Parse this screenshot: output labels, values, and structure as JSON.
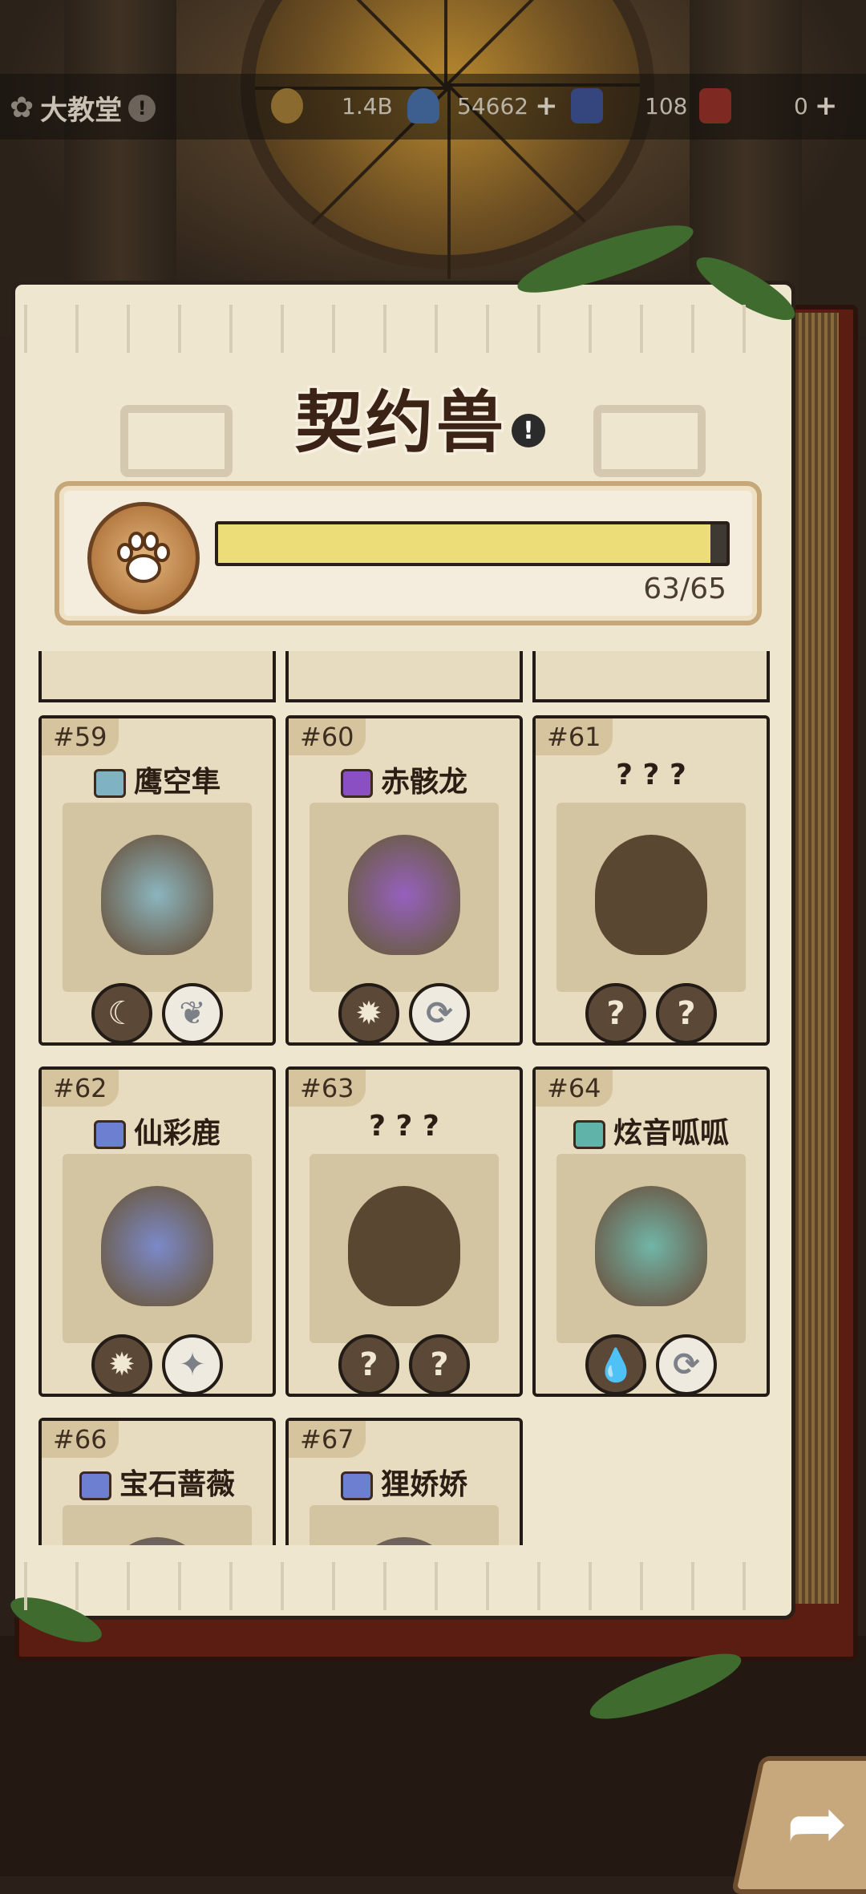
{
  "topbar": {
    "location": "大教堂",
    "info_icon": "!",
    "resources": [
      {
        "icon": "gold-coin-icon",
        "value": "1.4B",
        "plus": ""
      },
      {
        "icon": "blue-crystal-icon",
        "value": "54662",
        "plus": "+"
      },
      {
        "icon": "blue-ticket-icon",
        "value": "108",
        "plus": ""
      },
      {
        "icon": "red-ticket-icon",
        "value": "0",
        "plus": "+"
      }
    ]
  },
  "book": {
    "title": "契约兽",
    "info_icon": "!",
    "progress": {
      "collected": 63,
      "total": 65,
      "text": "63/65",
      "fraction": 0.969
    }
  },
  "cards": [
    {
      "num": "#59",
      "name": "鹰空隼",
      "emblem_color": "#7fb3c4",
      "known": true,
      "badges": [
        "moon",
        "leaf"
      ]
    },
    {
      "num": "#60",
      "name": "赤骸龙",
      "emblem_color": "#8b4fc4",
      "known": true,
      "badges": [
        "sun",
        "wind"
      ]
    },
    {
      "num": "#61",
      "name": "? ? ?",
      "emblem_color": "",
      "known": false,
      "badges": [
        "?",
        "?"
      ]
    },
    {
      "num": "#62",
      "name": "仙彩鹿",
      "emblem_color": "#6c7fd1",
      "known": true,
      "badges": [
        "sun",
        "star"
      ]
    },
    {
      "num": "#63",
      "name": "? ? ?",
      "emblem_color": "",
      "known": false,
      "badges": [
        "?",
        "?"
      ]
    },
    {
      "num": "#64",
      "name": "炫音呱呱",
      "emblem_color": "#5fb3a8",
      "known": true,
      "badges": [
        "water",
        "wind"
      ]
    },
    {
      "num": "#66",
      "name": "宝石蔷薇",
      "emblem_color": "#6c7fd1",
      "known": true,
      "badges": []
    },
    {
      "num": "#67",
      "name": "狸娇娇",
      "emblem_color": "#6c7fd1",
      "known": true,
      "badges": []
    }
  ],
  "next_button": {
    "icon": "arrow-right-icon",
    "glyph": "➦"
  },
  "colors": {
    "page": "#efe6cf",
    "card": "#e8dcc0",
    "progress_fill": "#ecdd79",
    "book_cover": "#5b1d12"
  }
}
